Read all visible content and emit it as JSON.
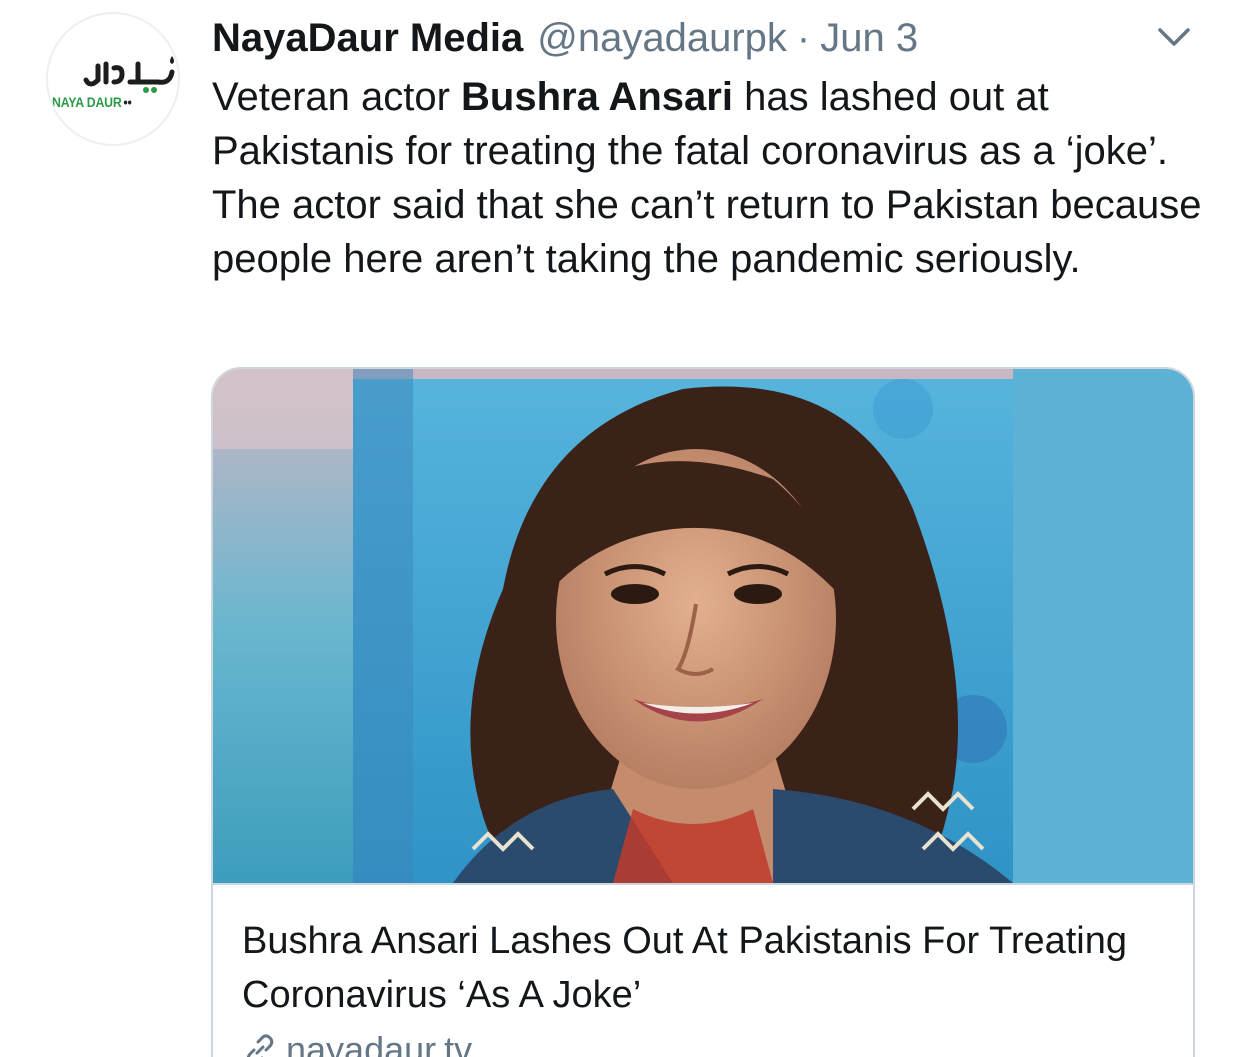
{
  "author": {
    "display_name": "NayaDaur Media",
    "handle": "@nayadaurpk",
    "separator": "·",
    "date": "Jun 3",
    "avatar_label": "NAYA DAUR",
    "avatar_urdu": "نیا دور"
  },
  "tweet": {
    "text_before": "Veteran actor ",
    "text_bold": "Bushra Ansari",
    "text_after": " has lashed out at Pakistanis for treating the fatal coronavirus as a ‘joke’. The actor said that she can’t return to Pakistan because people here aren’t taking the pandemic seriously."
  },
  "card": {
    "title": "Bushra Ansari Lashes Out At Pakistanis For Treating Coronavirus ‘As A Joke’",
    "domain": "nayadaur.tv"
  },
  "icons": {
    "menu": "chevron-down-icon",
    "link": "link-icon"
  },
  "colors": {
    "text": "#14171a",
    "secondary": "#657786",
    "border": "#ccd6dd",
    "brand_green": "#2c9a47"
  }
}
